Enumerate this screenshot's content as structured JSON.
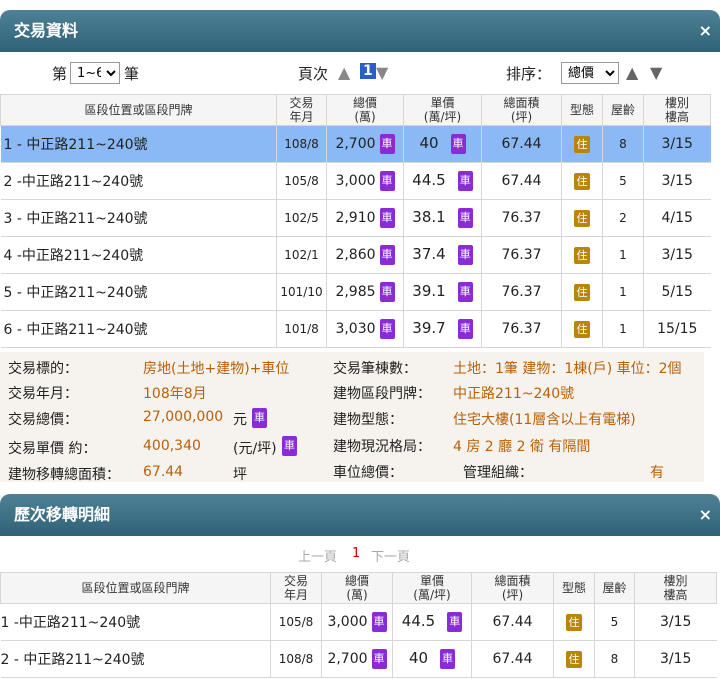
{
  "panel1": {
    "title": "交易資料",
    "close": "×"
  },
  "controls": {
    "range_prefix": "第",
    "range_value": "1~6",
    "range_suffix": "筆",
    "page_label": "頁次",
    "page_num": "1",
    "sort_label": "排序：",
    "sort_value": "總價",
    "up_arrow": "▲",
    "down_arrow": "▼"
  },
  "headers": {
    "location": "區段位置或區段門牌",
    "date": [
      "交易",
      "年月"
    ],
    "total": [
      "總價",
      "(萬)"
    ],
    "unit": [
      "單價",
      "(萬/坪)"
    ],
    "area": [
      "總面積",
      "(坪)"
    ],
    "type": "型態",
    "age": "屋齡",
    "floor": [
      "樓別",
      "樓高"
    ]
  },
  "badges": {
    "car": "車",
    "res": "住"
  },
  "rows": [
    {
      "idx": "1",
      "location": "- 中正路211~240號",
      "date": "108/8",
      "total": "2,700",
      "unit": "40",
      "area": "67.44",
      "age": "8",
      "floor": "3/15"
    },
    {
      "idx": "2",
      "location": "-中正路211~240號",
      "date": "105/8",
      "total": "3,000",
      "unit": "44.5",
      "area": "67.44",
      "age": "5",
      "floor": "3/15"
    },
    {
      "idx": "3",
      "location": "- 中正路211~240號",
      "date": "102/5",
      "total": "2,910",
      "unit": "38.1",
      "area": "76.37",
      "age": "2",
      "floor": "4/15"
    },
    {
      "idx": "4",
      "location": "-中正路211~240號",
      "date": "102/1",
      "total": "2,860",
      "unit": "37.4",
      "area": "76.37",
      "age": "1",
      "floor": "3/15"
    },
    {
      "idx": "5",
      "location": "- 中正路211~240號",
      "date": "101/10",
      "total": "2,985",
      "unit": "39.1",
      "area": "76.37",
      "age": "1",
      "floor": "5/15"
    },
    {
      "idx": "6",
      "location": "- 中正路211~240號",
      "date": "101/8",
      "total": "3,030",
      "unit": "39.7",
      "area": "76.37",
      "age": "1",
      "floor": "15/15"
    }
  ],
  "detail": {
    "target_label": "交易標的：",
    "target_value": "房地(土地+建物)+車位",
    "date_label": "交易年月：",
    "date_value": "108年8月",
    "total_label": "交易總價：",
    "total_value": "27,000,000",
    "total_unit": "元",
    "unit_label": "交易單價 約：",
    "unit_value": "400,340",
    "unit_unit": "(元/坪)",
    "area_label": "建物移轉總面積：",
    "area_value": "67.44",
    "area_unit": "坪",
    "count_label": "交易筆棟數：",
    "count_value": "土地：1筆 建物：1棟(戶) 車位：2個",
    "addr_label": "建物區段門牌：",
    "addr_value": "中正路211~240號",
    "btype_label": "建物型態：",
    "btype_value": "住宅大樓(11層含以上有電梯)",
    "layout_label": "建物現況格局：",
    "layout_value": "4 房 2 廳 2 衛 有隔間",
    "parking_label": "車位總價：",
    "mgmt_label": "管理組織：",
    "mgmt_value": "有"
  },
  "panel2": {
    "title": "歷次移轉明細",
    "close": "×"
  },
  "pager": {
    "prev": "上一頁",
    "current": "1",
    "next": "下一頁"
  },
  "history": [
    {
      "idx": "1",
      "location": "-中正路211~240號",
      "date": "105/8",
      "total": "3,000",
      "unit": "44.5",
      "area": "67.44",
      "age": "5",
      "floor": "3/15"
    },
    {
      "idx": "2",
      "location": "- 中正路211~240號",
      "date": "108/8",
      "total": "2,700",
      "unit": "40",
      "area": "67.44",
      "age": "8",
      "floor": "3/15"
    }
  ]
}
